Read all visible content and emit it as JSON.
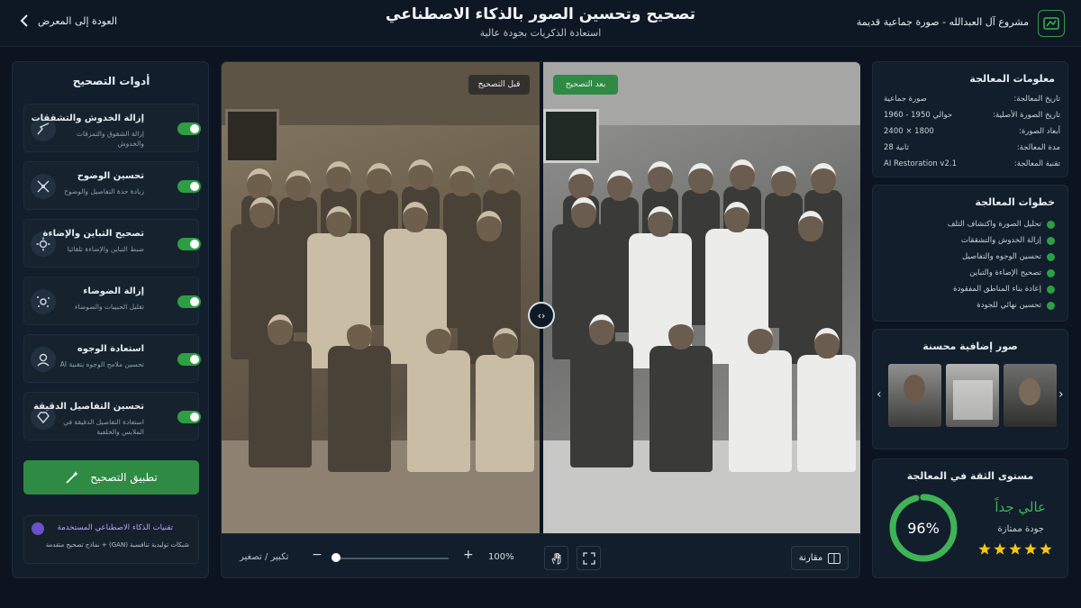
{
  "header": {
    "back_label": "العودة إلى المعرض",
    "title": "تصحيح وتحسين الصور بالذكاء الاصطناعي",
    "subtitle": "استعادة الذكريات بجودة عالية",
    "project_name": "مشروع آل العبدالله - صورة جماعية قديمة"
  },
  "tools": {
    "title": "أدوات التصحيح",
    "items": [
      {
        "name": "إزالة الخدوش والتشققات",
        "desc": "إزالة الشقوق والتمزقات والخدوش",
        "enabled": true,
        "icon": "crack-icon"
      },
      {
        "name": "تحسين الوضوح",
        "desc": "زيادة حدة التفاصيل والوضوح",
        "enabled": true,
        "icon": "sharpen-icon"
      },
      {
        "name": "تصحيح التباين والإضاءة",
        "desc": "ضبط التباين والإضاءة تلقائيا",
        "enabled": true,
        "icon": "sun-icon"
      },
      {
        "name": "إزالة الضوضاء",
        "desc": "تقليل الحبيبات والضوضاء",
        "enabled": true,
        "icon": "noise-icon"
      },
      {
        "name": "استعادة الوجوه",
        "desc": "تحسين ملامح الوجوه بتقنية AI",
        "enabled": true,
        "icon": "face-icon"
      },
      {
        "name": "تحسين التفاصيل الدقيقة",
        "desc": "استعادة التفاصيل الدقيقة في الملابس والخلفية",
        "enabled": true,
        "icon": "detail-icon"
      }
    ],
    "apply_label": "تطبيق التصحيح",
    "ai_title": "تقنيات الذكاء الاصطناعي المستخدمة",
    "ai_desc": "شبكات توليدية تنافسية (GAN) + نماذج تصحيح متقدمة"
  },
  "viewer": {
    "before_label": "قبل التصحيح",
    "after_label": "بعد التصحيح",
    "zoom_label": "تكبير / تصغير",
    "zoom_minus": "−",
    "zoom_plus": "+",
    "zoom_value": "100%",
    "zoom_fraction": 0.0,
    "compare_label": "مقارنة",
    "split_icon": "‹›"
  },
  "info": {
    "title": "معلومات المعالجة",
    "rows": [
      {
        "key": "تاريخ المعالجة:",
        "value": "صورة جماعية"
      },
      {
        "key": "تاريخ الصورة الأصلية:",
        "value": "حوالي 1950 - 1960"
      },
      {
        "key": "أبعاد الصورة:",
        "value": "2400 × 1800"
      },
      {
        "key": "مدة المعالجة:",
        "value": "28 ثانية"
      },
      {
        "key": "تقنية المعالجة:",
        "value": "AI Restoration v2.1"
      }
    ]
  },
  "steps": {
    "title": "خطوات المعالجة",
    "items": [
      "تحليل الصورة واكتشاف التلف",
      "إزالة الخدوش والتشققات",
      "تحسين الوجوه والتفاصيل",
      "تصحيح الإضاءة والتباين",
      "إعادة بناء المناطق المفقودة",
      "تحسين نهائي للجودة"
    ]
  },
  "thumbs": {
    "title": "صور إضافية محسنة",
    "prev": "‹",
    "next": "›"
  },
  "confidence": {
    "title": "مستوى الثقة في المعالجة",
    "value": "96%",
    "fraction": 0.96,
    "level": "عالي جداً",
    "quality": "جودة ممتازة",
    "stars": 5
  },
  "colors": {
    "accent": "#2e9e44",
    "bg": "#0b1420",
    "panel": "#121e2b"
  }
}
